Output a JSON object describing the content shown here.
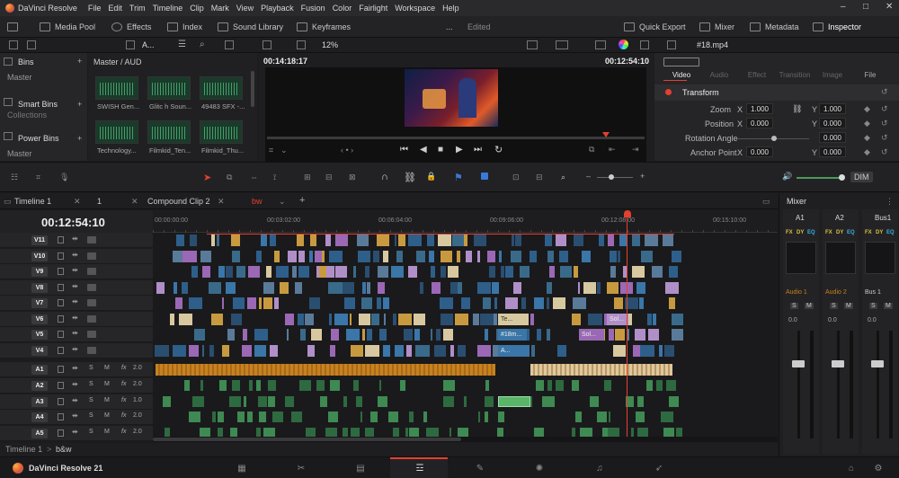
{
  "menubar": {
    "app": "DaVinci Resolve",
    "items": [
      "File",
      "Edit",
      "Trim",
      "Timeline",
      "Clip",
      "Mark",
      "View",
      "Playback",
      "Fusion",
      "Color",
      "Fairlight",
      "Workspace",
      "Help"
    ]
  },
  "toolbar": {
    "media_pool": "Media Pool",
    "effects": "Effects",
    "index": "Index",
    "sound_library": "Sound Library",
    "keyframes": "Keyframes",
    "more": "...",
    "edited": "Edited",
    "quick_export": "Quick Export",
    "mixer": "Mixer",
    "metadata": "Metadata",
    "inspector": "Inspector"
  },
  "subbar": {
    "sort": "A...",
    "zoom": "12%",
    "clip_name": "#18.mp4"
  },
  "bins": {
    "header": "Bins",
    "master": "Master",
    "smart_bins": "Smart Bins",
    "collections": "Collections",
    "power_bins": "Power Bins",
    "power_master": "Master"
  },
  "media": {
    "path": "Master / AUD",
    "clips": [
      "SWISH Gen...",
      "Glitc h Soun...",
      "49483 SFX -...",
      "Technology...",
      "Filmkid_Ten...",
      "Filmkid_Thu..."
    ]
  },
  "viewer": {
    "source_tc": "00:14:18:17",
    "record_tc": "00:12:54:10"
  },
  "inspector": {
    "tabs": [
      "Video",
      "Audio",
      "Effect",
      "Transition",
      "Image",
      "File"
    ],
    "section": "Transform",
    "zoom_label": "Zoom",
    "zoom_x": "1.000",
    "zoom_y": "1.000",
    "position_label": "Position",
    "pos_x": "0.000",
    "pos_y": "0.000",
    "rotation_label": "Rotation Angle",
    "rotation": "0.000",
    "anchor_label": "Anchor Point",
    "anchor_x": "0.000",
    "anchor_y": "0.000",
    "x": "X",
    "y": "Y"
  },
  "timeline_tabs": {
    "timeline1": "Timeline 1",
    "num": "1",
    "compound": "Compound Clip 2",
    "bw": "bw",
    "add": "+"
  },
  "timecode": "00:12:54:10",
  "ruler": [
    "00:00:00:00",
    "00:03:02:00",
    "00:06:04:00",
    "00:09:06:00",
    "00:12:08:00",
    "00:15:10:00"
  ],
  "video_tracks": [
    "V11",
    "V10",
    "V9",
    "V8",
    "V7",
    "V6",
    "V5",
    "V4"
  ],
  "audio_tracks": [
    {
      "name": "A1",
      "fx": "2.0"
    },
    {
      "name": "A2",
      "fx": "2.0"
    },
    {
      "name": "A3",
      "fx": "1.0"
    },
    {
      "name": "A4",
      "fx": "2.0"
    },
    {
      "name": "A5",
      "fx": "2.0"
    }
  ],
  "clip_labels": {
    "te": "Te...",
    "mp4": "#18m...",
    "a": "A...",
    "sol1": "Sol...",
    "sol2": "Sol..."
  },
  "mixer": {
    "title": "Mixer",
    "channels": [
      "A1",
      "A2",
      "Bus1"
    ],
    "inputs": [
      "Audio 1",
      "Audio 2",
      "Bus 1"
    ],
    "fx": [
      "FX",
      "DY",
      "EQ"
    ],
    "db": "0.0",
    "s": "S",
    "m": "M"
  },
  "audio_letters": {
    "s": "S",
    "m": "M",
    "fx": "fx"
  },
  "breadcrumb": {
    "timeline": "Timeline 1",
    "sep": ">",
    "current": "b&w"
  },
  "bottom": {
    "brand": "DaVinci Resolve 21"
  },
  "dim": "DIM",
  "colors": {
    "accent": "#e4402f",
    "audio": "#c8821e",
    "green": "#4a9a5a",
    "blue": "#2e6fa8",
    "purple": "#9a68b4",
    "beige": "#d8c8a0"
  }
}
